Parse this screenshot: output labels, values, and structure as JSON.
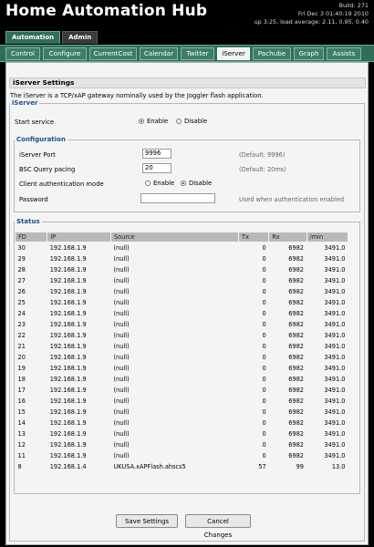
{
  "header": {
    "title": "Home Automation Hub",
    "build": "Build: 271",
    "date": "Fri Dec 3 01:40:19 2010",
    "uptime": "up 3:25, load average: 2.11, 0.95, 0.40"
  },
  "top_tabs": [
    "Automation",
    "Admin"
  ],
  "sub_tabs": [
    "Control",
    "Configure",
    "CurrentCost",
    "Calendar",
    "Twitter",
    "iServer",
    "Pachube",
    "Graph",
    "Assists"
  ],
  "page": {
    "section_title": "iServer Settings",
    "intro": "The iServer is a TCP/xAP gateway nominally used by the Joggler flash application.",
    "iserver_legend": "iServer",
    "start_service_label": "Start service",
    "enable_label": "Enable",
    "disable_label": "Disable",
    "config_legend": "Configuration",
    "port_label": "iServer Port",
    "port_value": "9996",
    "port_hint": "(Default: 9996)",
    "bsc_label": "BSC Query pacing",
    "bsc_value": "20",
    "bsc_hint": "(Default: 20ms)",
    "auth_label": "Client authentication mode",
    "password_label": "Password",
    "password_hint": "Used when authentication enabled",
    "status_legend": "Status"
  },
  "status_table": {
    "headers": [
      "FD",
      "IP",
      "Source",
      "Tx",
      "Rx",
      "/min"
    ],
    "rows": [
      [
        "30",
        "192.168.1.9",
        "(null)",
        "0",
        "6982",
        "3491.0"
      ],
      [
        "29",
        "192.168.1.9",
        "(null)",
        "0",
        "6982",
        "3491.0"
      ],
      [
        "28",
        "192.168.1.9",
        "(null)",
        "0",
        "6982",
        "3491.0"
      ],
      [
        "27",
        "192.168.1.9",
        "(null)",
        "0",
        "6982",
        "3491.0"
      ],
      [
        "26",
        "192.168.1.9",
        "(null)",
        "0",
        "6982",
        "3491.0"
      ],
      [
        "25",
        "192.168.1.9",
        "(null)",
        "0",
        "6982",
        "3491.0"
      ],
      [
        "24",
        "192.168.1.9",
        "(null)",
        "0",
        "6982",
        "3491.0"
      ],
      [
        "23",
        "192.168.1.9",
        "(null)",
        "0",
        "6982",
        "3491.0"
      ],
      [
        "22",
        "192.168.1.9",
        "(null)",
        "0",
        "6982",
        "3491.0"
      ],
      [
        "21",
        "192.168.1.9",
        "(null)",
        "0",
        "6982",
        "3491.0"
      ],
      [
        "20",
        "192.168.1.9",
        "(null)",
        "0",
        "6982",
        "3491.0"
      ],
      [
        "19",
        "192.168.1.9",
        "(null)",
        "0",
        "6982",
        "3491.0"
      ],
      [
        "18",
        "192.168.1.9",
        "(null)",
        "0",
        "6982",
        "3491.0"
      ],
      [
        "17",
        "192.168.1.9",
        "(null)",
        "0",
        "6982",
        "3491.0"
      ],
      [
        "16",
        "192.168.1.9",
        "(null)",
        "0",
        "6982",
        "3491.0"
      ],
      [
        "15",
        "192.168.1.9",
        "(null)",
        "0",
        "6982",
        "3491.0"
      ],
      [
        "14",
        "192.168.1.9",
        "(null)",
        "0",
        "6982",
        "3491.0"
      ],
      [
        "13",
        "192.168.1.9",
        "(null)",
        "0",
        "6982",
        "3491.0"
      ],
      [
        "12",
        "192.168.1.9",
        "(null)",
        "0",
        "6982",
        "3491.0"
      ],
      [
        "11",
        "192.168.1.9",
        "(null)",
        "0",
        "6982",
        "3491.0"
      ],
      [
        "8",
        "192.168.1.4",
        "UKUSA.xAPFlash.ahscs5",
        "57",
        "99",
        "13.0"
      ]
    ]
  },
  "buttons": {
    "save": "Save Settings",
    "cancel": "Cancel Changes"
  }
}
